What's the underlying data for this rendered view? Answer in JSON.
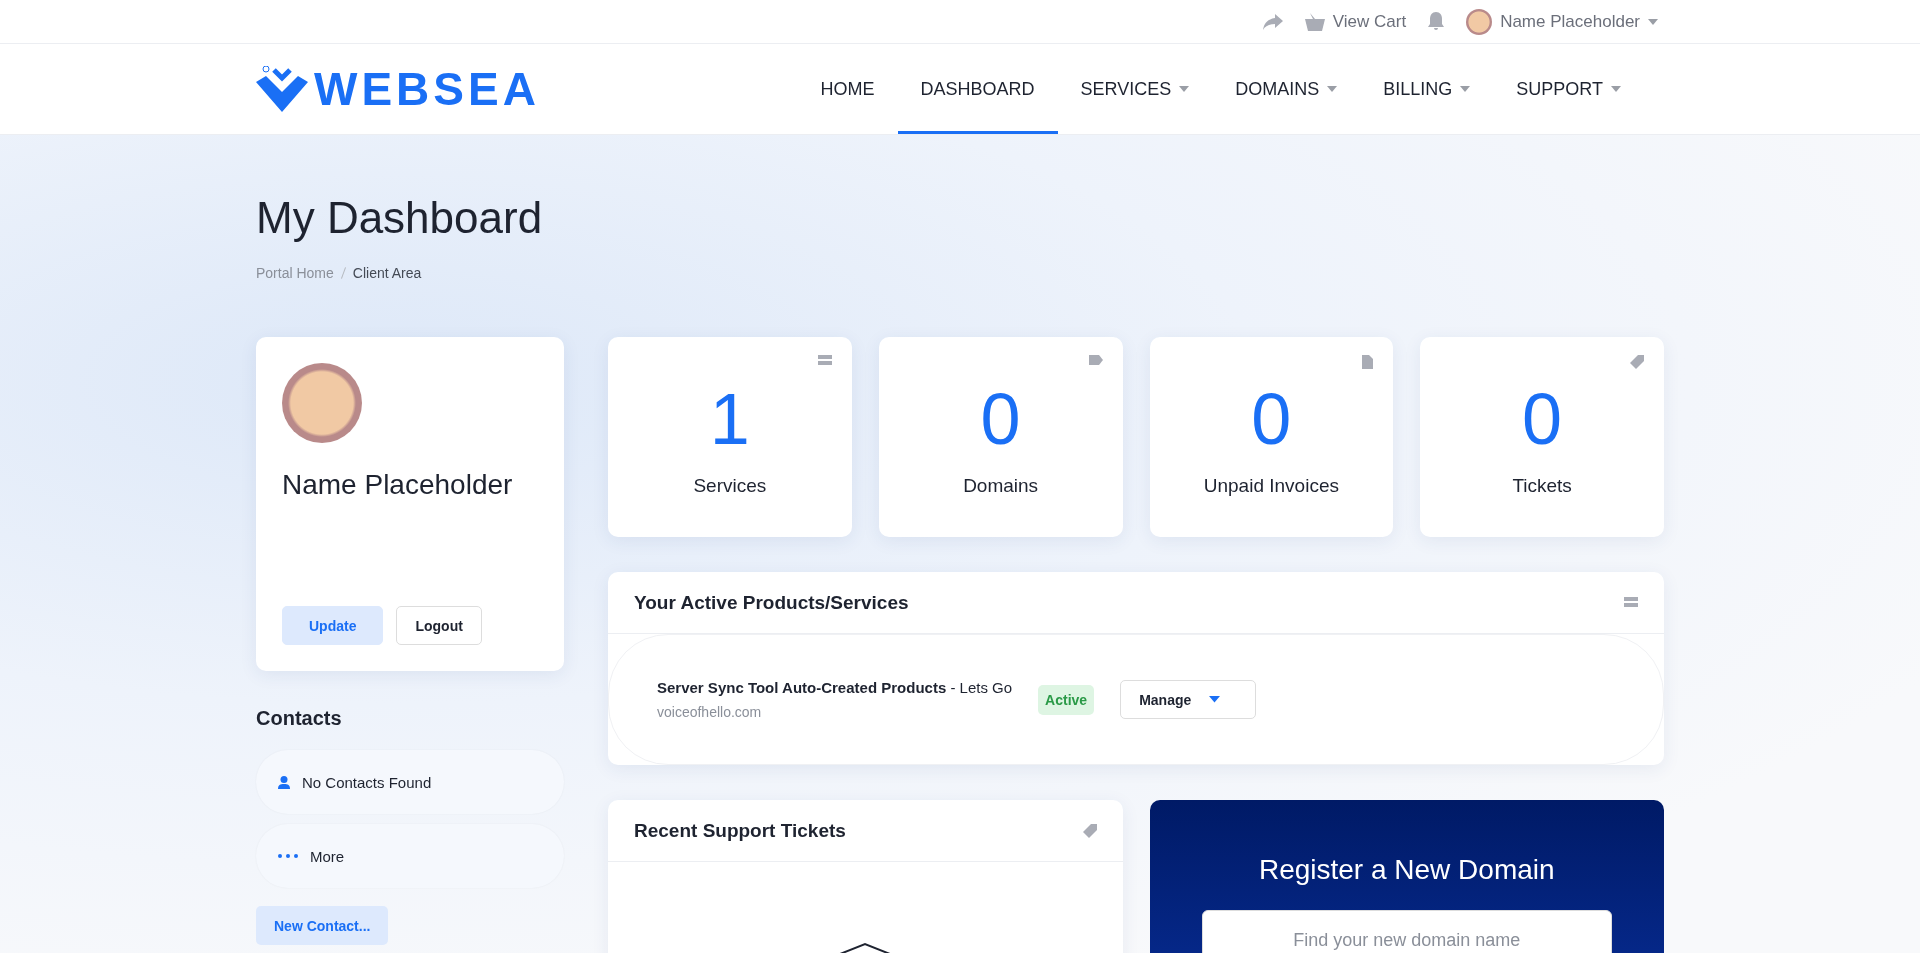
{
  "top_bar": {
    "cart_label": "View Cart",
    "user_name": "Name Placeholder"
  },
  "brand": {
    "name": "WEBSEA"
  },
  "nav": [
    {
      "label": "HOME",
      "selected": false,
      "dropdown": false
    },
    {
      "label": "DASHBOARD",
      "selected": true,
      "dropdown": false
    },
    {
      "label": "SERVICES",
      "selected": false,
      "dropdown": true
    },
    {
      "label": "DOMAINS",
      "selected": false,
      "dropdown": true
    },
    {
      "label": "BILLING",
      "selected": false,
      "dropdown": true
    },
    {
      "label": "SUPPORT",
      "selected": false,
      "dropdown": true
    }
  ],
  "page": {
    "title": "My Dashboard",
    "breadcrumb": [
      "Portal Home",
      "Client Area"
    ]
  },
  "profile": {
    "name": "Name Placeholder",
    "buttons": [
      "Update",
      "Logout"
    ]
  },
  "contacts": {
    "title": "Contacts",
    "items": [
      {
        "kind": "person",
        "label": "No Contacts Found"
      },
      {
        "kind": "more",
        "label": "More"
      }
    ],
    "new_button": "New Contact..."
  },
  "stats": [
    {
      "kind": "services",
      "value": "1",
      "label": "Services"
    },
    {
      "kind": "domains",
      "value": "0",
      "label": "Domains"
    },
    {
      "kind": "invoices",
      "value": "0",
      "label": "Unpaid Invoices"
    },
    {
      "kind": "tickets",
      "value": "0",
      "label": "Tickets"
    }
  ],
  "products": {
    "title": "Your Active Products/Services",
    "items": [
      {
        "name": "Server Sync Tool Auto-Created Products",
        "suffix": " - Lets Go",
        "domain": "voiceofhello.com",
        "status": "Active",
        "action": "Manage"
      }
    ]
  },
  "tickets": {
    "title": "Recent Support Tickets"
  },
  "register": {
    "title": "Register a New Domain",
    "placeholder": "Find your new domain name"
  }
}
